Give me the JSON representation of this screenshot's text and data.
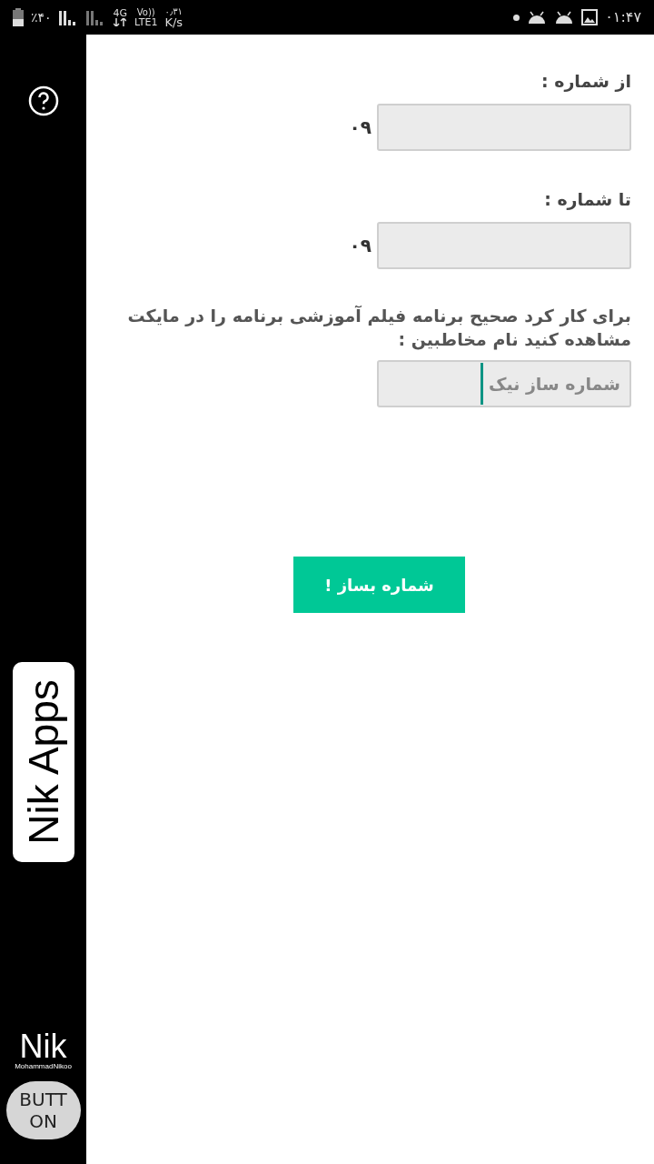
{
  "status_bar": {
    "battery": "٪۴۰",
    "network": "4G",
    "volte": "Vo))",
    "lte": "LTE1",
    "speed": "۰٫۳۱",
    "speed_unit": "K/s",
    "time": "۰۱:۴۷"
  },
  "sidebar": {
    "logo_card": "Nik Apps",
    "logo": "Nik",
    "logo_caption": "MohammadNikoo",
    "button": "BUTT ON"
  },
  "form": {
    "fields": [
      {
        "label": "از شماره :",
        "prefix": "۰۹"
      },
      {
        "label": "تا شماره :",
        "prefix": "۰۹"
      }
    ],
    "note": "برای کار کرد صحیح برنامه فیلم آموزشی برنامه را در مایکت مشاهده کنید  نام مخاطبین :",
    "name_field": {
      "placeholder": "شماره ساز نیک",
      "focused": true
    },
    "submit": "شماره بساز !"
  }
}
